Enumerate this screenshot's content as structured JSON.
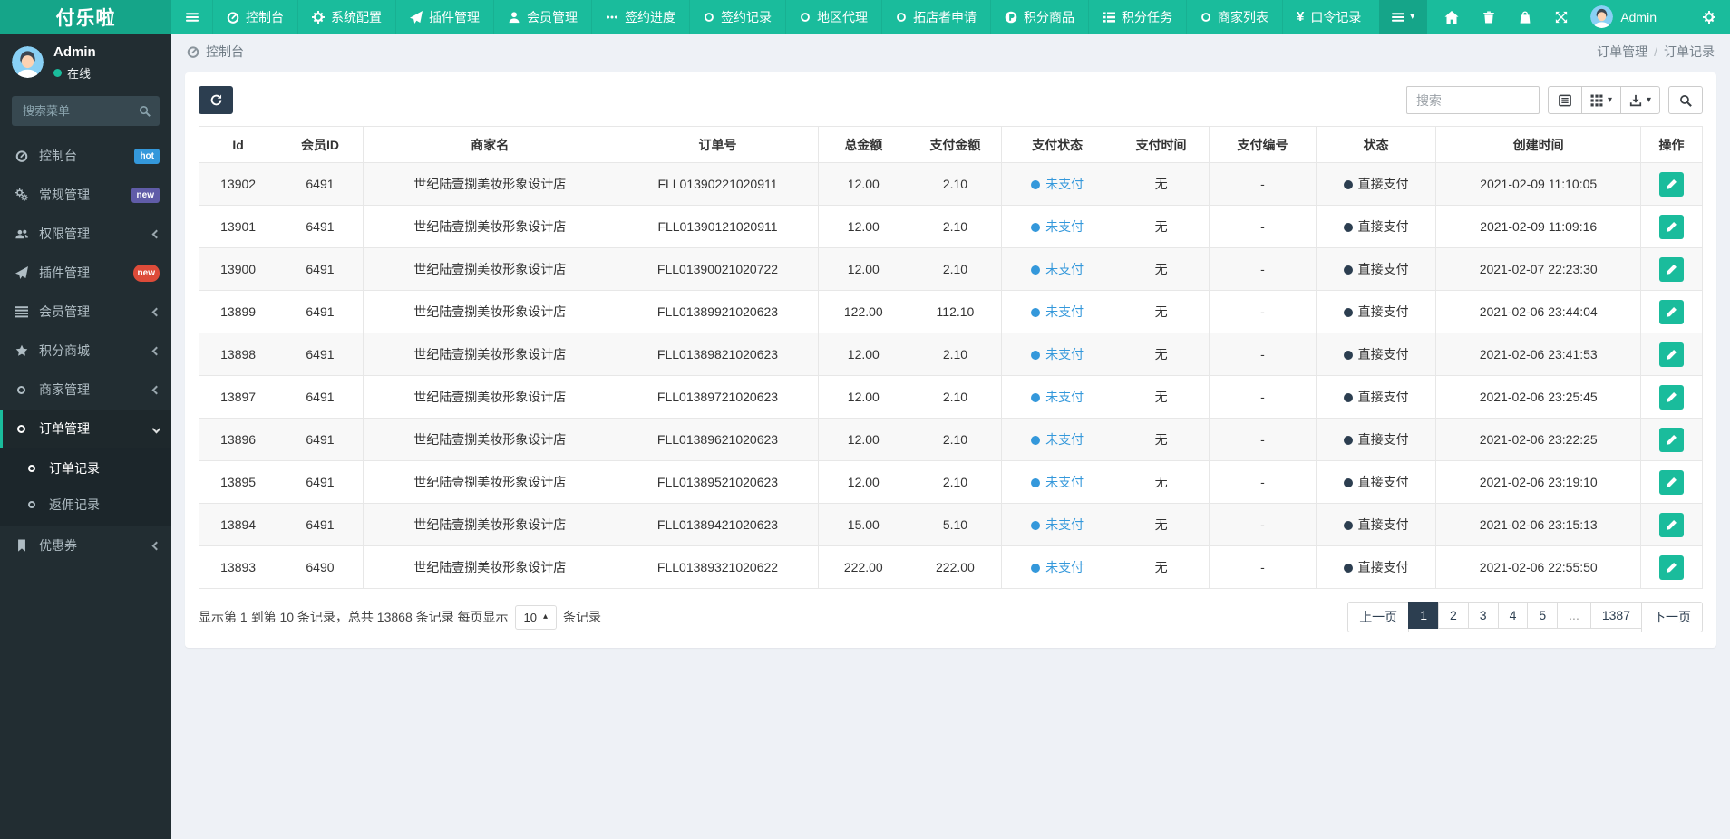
{
  "colors": {
    "accent_green": "#1abc9c",
    "brand_green_dark": "#15a589",
    "dark_navy": "#2c3e50",
    "sidebar_bg": "#222d32",
    "content_bg": "#eef1f6",
    "badge_hot_blue": "#3498db",
    "badge_new_purple": "#605ca8",
    "badge_new_red": "#dd4b39",
    "unpaid_blue": "#3498db"
  },
  "navbar": {
    "brand": "付乐啦",
    "items": [
      {
        "label": "控制台",
        "icon": "dashboard-icon"
      },
      {
        "label": "系统配置",
        "icon": "gear-icon"
      },
      {
        "label": "插件管理",
        "icon": "paper-plane-icon"
      },
      {
        "label": "会员管理",
        "icon": "user-icon"
      },
      {
        "label": "签约进度",
        "icon": "ellipsis-icon"
      },
      {
        "label": "签约记录",
        "icon": "circle-icon"
      },
      {
        "label": "地区代理",
        "icon": "circle-icon"
      },
      {
        "label": "拓店者申请",
        "icon": "circle-icon"
      },
      {
        "label": "积分商品",
        "icon": "p-coin-icon"
      },
      {
        "label": "积分任务",
        "icon": "task-list-icon"
      },
      {
        "label": "商家列表",
        "icon": "circle-icon"
      },
      {
        "label": "口令记录",
        "icon": "yen-icon",
        "glyph": "¥"
      }
    ],
    "user_label": "Admin"
  },
  "sidebar": {
    "user": {
      "name": "Admin",
      "status": "在线"
    },
    "search_placeholder": "搜索菜单",
    "items": [
      {
        "label": "控制台",
        "icon": "dashboard-icon",
        "badge": {
          "text": "hot",
          "color": "blue"
        }
      },
      {
        "label": "常规管理",
        "icon": "gears-icon",
        "badge": {
          "text": "new",
          "color": "purple"
        }
      },
      {
        "label": "权限管理",
        "icon": "users-icon"
      },
      {
        "label": "插件管理",
        "icon": "paper-plane-icon",
        "badge": {
          "text": "new",
          "color": "red"
        }
      },
      {
        "label": "会员管理",
        "icon": "list-icon"
      },
      {
        "label": "积分商城",
        "icon": "star-icon"
      },
      {
        "label": "商家管理",
        "icon": "circle-icon"
      },
      {
        "label": "订单管理",
        "icon": "circle-icon",
        "expanded": true,
        "children": [
          {
            "label": "订单记录",
            "active": true
          },
          {
            "label": "返佣记录",
            "active": false
          }
        ]
      },
      {
        "label": "优惠券",
        "icon": "bookmark-icon"
      }
    ]
  },
  "breadcrumb": {
    "location": "控制台",
    "trail_parent": "订单管理",
    "separator": "/",
    "trail_current": "订单记录"
  },
  "toolbar": {
    "search_placeholder": "搜索"
  },
  "table": {
    "columns": [
      "Id",
      "会员ID",
      "商家名",
      "订单号",
      "总金额",
      "支付金额",
      "支付状态",
      "支付时间",
      "支付编号",
      "状态",
      "创建时间",
      "操作"
    ],
    "rows": [
      {
        "id": "13902",
        "member_id": "6491",
        "merchant": "世纪陆壹捌美妆形象设计店",
        "order_no": "FLL01390221020911",
        "total": "12.00",
        "paid": "2.10",
        "pay_status": "未支付",
        "pay_time": "无",
        "pay_no": "-",
        "status": "直接支付",
        "created": "2021-02-09 11:10:05"
      },
      {
        "id": "13901",
        "member_id": "6491",
        "merchant": "世纪陆壹捌美妆形象设计店",
        "order_no": "FLL01390121020911",
        "total": "12.00",
        "paid": "2.10",
        "pay_status": "未支付",
        "pay_time": "无",
        "pay_no": "-",
        "status": "直接支付",
        "created": "2021-02-09 11:09:16"
      },
      {
        "id": "13900",
        "member_id": "6491",
        "merchant": "世纪陆壹捌美妆形象设计店",
        "order_no": "FLL01390021020722",
        "total": "12.00",
        "paid": "2.10",
        "pay_status": "未支付",
        "pay_time": "无",
        "pay_no": "-",
        "status": "直接支付",
        "created": "2021-02-07 22:23:30"
      },
      {
        "id": "13899",
        "member_id": "6491",
        "merchant": "世纪陆壹捌美妆形象设计店",
        "order_no": "FLL01389921020623",
        "total": "122.00",
        "paid": "112.10",
        "pay_status": "未支付",
        "pay_time": "无",
        "pay_no": "-",
        "status": "直接支付",
        "created": "2021-02-06 23:44:04"
      },
      {
        "id": "13898",
        "member_id": "6491",
        "merchant": "世纪陆壹捌美妆形象设计店",
        "order_no": "FLL01389821020623",
        "total": "12.00",
        "paid": "2.10",
        "pay_status": "未支付",
        "pay_time": "无",
        "pay_no": "-",
        "status": "直接支付",
        "created": "2021-02-06 23:41:53"
      },
      {
        "id": "13897",
        "member_id": "6491",
        "merchant": "世纪陆壹捌美妆形象设计店",
        "order_no": "FLL01389721020623",
        "total": "12.00",
        "paid": "2.10",
        "pay_status": "未支付",
        "pay_time": "无",
        "pay_no": "-",
        "status": "直接支付",
        "created": "2021-02-06 23:25:45"
      },
      {
        "id": "13896",
        "member_id": "6491",
        "merchant": "世纪陆壹捌美妆形象设计店",
        "order_no": "FLL01389621020623",
        "total": "12.00",
        "paid": "2.10",
        "pay_status": "未支付",
        "pay_time": "无",
        "pay_no": "-",
        "status": "直接支付",
        "created": "2021-02-06 23:22:25"
      },
      {
        "id": "13895",
        "member_id": "6491",
        "merchant": "世纪陆壹捌美妆形象设计店",
        "order_no": "FLL01389521020623",
        "total": "12.00",
        "paid": "2.10",
        "pay_status": "未支付",
        "pay_time": "无",
        "pay_no": "-",
        "status": "直接支付",
        "created": "2021-02-06 23:19:10"
      },
      {
        "id": "13894",
        "member_id": "6491",
        "merchant": "世纪陆壹捌美妆形象设计店",
        "order_no": "FLL01389421020623",
        "total": "15.00",
        "paid": "5.10",
        "pay_status": "未支付",
        "pay_time": "无",
        "pay_no": "-",
        "status": "直接支付",
        "created": "2021-02-06 23:15:13"
      },
      {
        "id": "13893",
        "member_id": "6490",
        "merchant": "世纪陆壹捌美妆形象设计店",
        "order_no": "FLL01389321020622",
        "total": "222.00",
        "paid": "222.00",
        "pay_status": "未支付",
        "pay_time": "无",
        "pay_no": "-",
        "status": "直接支付",
        "created": "2021-02-06 22:55:50"
      }
    ]
  },
  "footer": {
    "summary_prefix": "显示第 1 到第 10 条记录，总共 13868 条记录 每页显示",
    "page_size": "10",
    "summary_suffix": "条记录",
    "pagination": [
      {
        "label": "上一页",
        "name": "prev-page-button"
      },
      {
        "label": "1",
        "active": true,
        "name": "page-1-button"
      },
      {
        "label": "2",
        "name": "page-2-button"
      },
      {
        "label": "3",
        "name": "page-3-button"
      },
      {
        "label": "4",
        "name": "page-4-button"
      },
      {
        "label": "5",
        "name": "page-5-button"
      },
      {
        "label": "...",
        "disabled": true,
        "name": "page-ellipsis"
      },
      {
        "label": "1387",
        "name": "page-1387-button"
      },
      {
        "label": "下一页",
        "name": "next-page-button"
      }
    ]
  }
}
